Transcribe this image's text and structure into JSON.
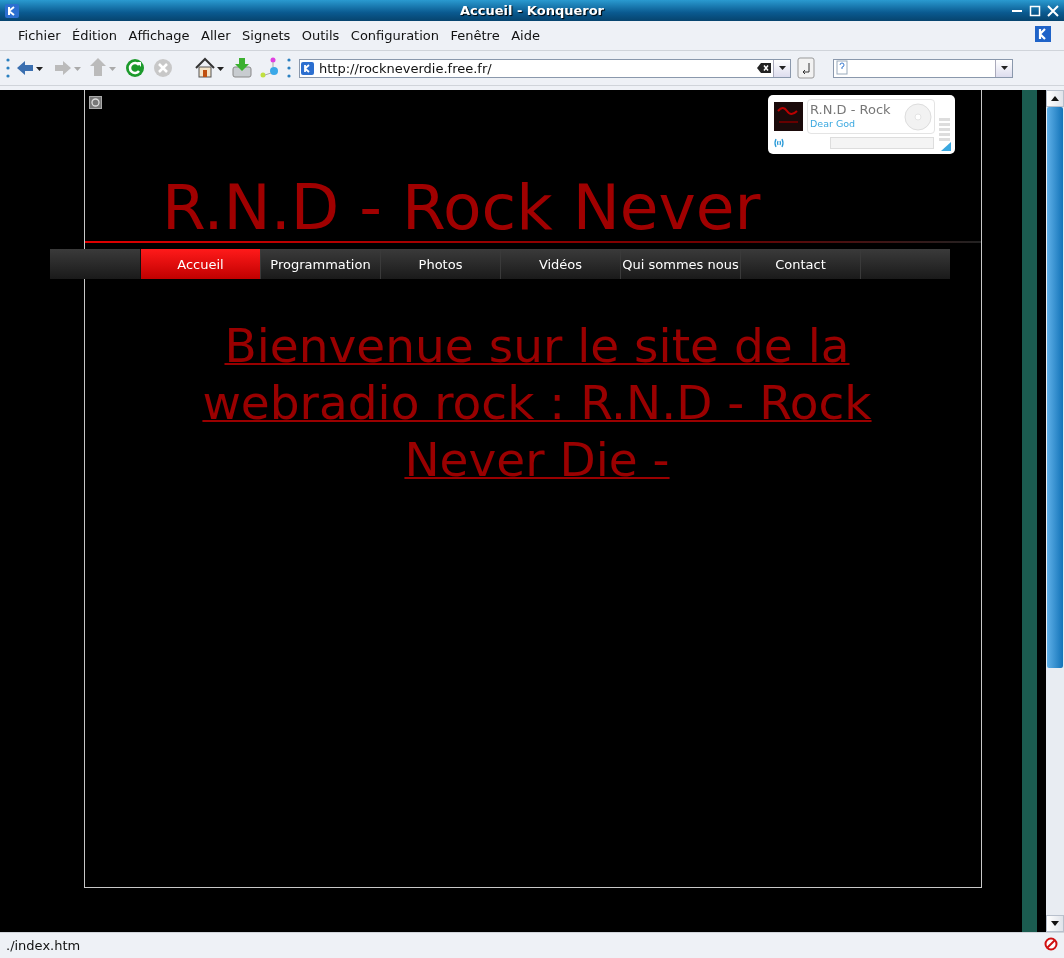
{
  "window": {
    "title": "Accueil - Konqueror"
  },
  "menu": [
    {
      "label": "Fichier"
    },
    {
      "label": "Édition"
    },
    {
      "label": "Affichage"
    },
    {
      "label": "Aller"
    },
    {
      "label": "Signets"
    },
    {
      "label": "Outils"
    },
    {
      "label": "Configuration"
    },
    {
      "label": "Fenêtre"
    },
    {
      "label": "Aide"
    }
  ],
  "toolbar": {
    "url": "http://rockneverdie.free.fr/"
  },
  "page": {
    "heading": "R.N.D - Rock Never",
    "nav": [
      {
        "label": "Accueil",
        "selected": true
      },
      {
        "label": "Programmation",
        "selected": false
      },
      {
        "label": "Photos",
        "selected": false
      },
      {
        "label": "Vidéos",
        "selected": false
      },
      {
        "label": "Qui sommes nous",
        "selected": false
      },
      {
        "label": "Contact",
        "selected": false
      }
    ],
    "welcome": "Bienvenue sur le site de la webradio rock : R.N.D - Rock Never Die -",
    "player": {
      "station": "R.N.D - Rock",
      "track": "Dear God"
    }
  },
  "status_bar": {
    "text": "./index.htm"
  }
}
